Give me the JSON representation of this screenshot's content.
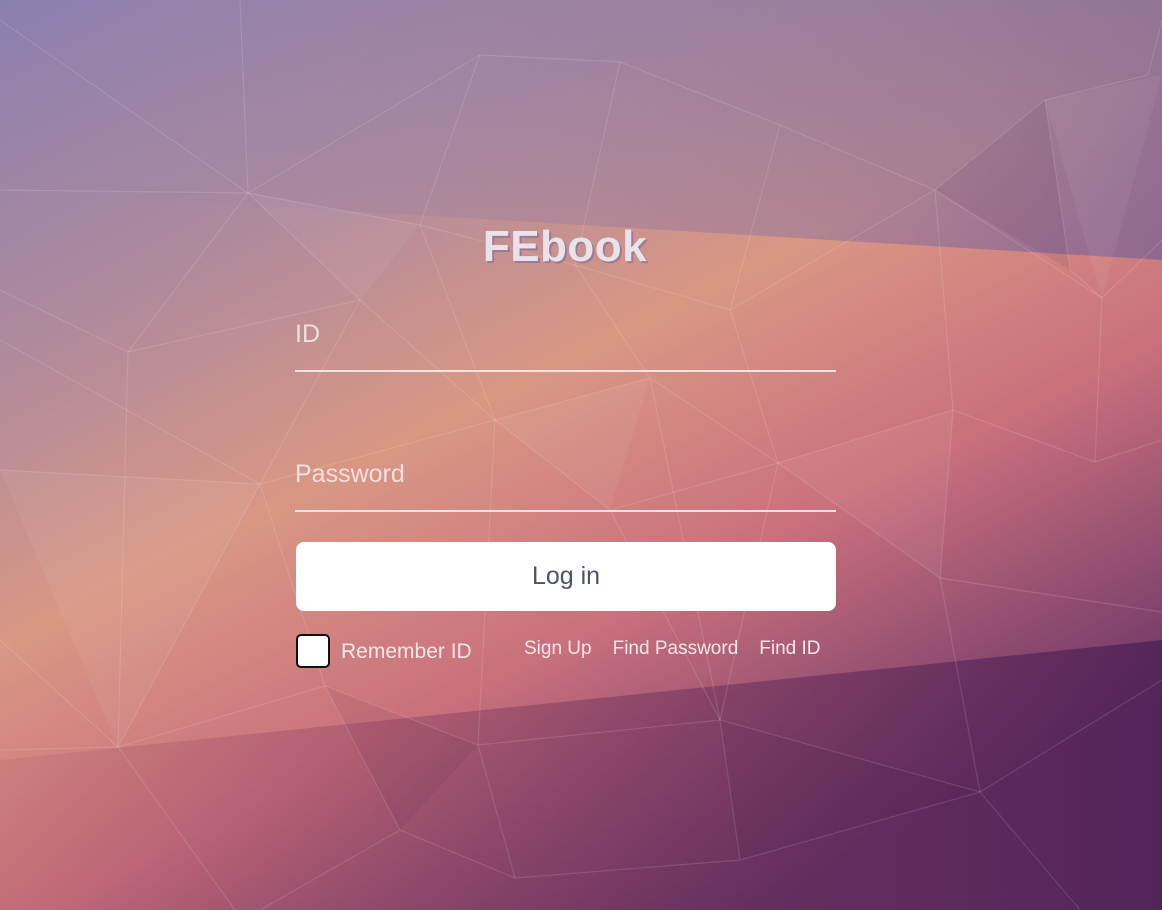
{
  "app": {
    "title": "FEbook"
  },
  "form": {
    "id_placeholder": "ID",
    "id_value": "",
    "password_placeholder": "Password",
    "password_value": "",
    "login_label": "Log in",
    "remember_label": "Remember ID",
    "remember_checked": false
  },
  "links": {
    "sign_up": "Sign Up",
    "find_password": "Find Password",
    "find_id": "Find ID"
  },
  "colors": {
    "bg_top": "#7b6fa8",
    "bg_mid": "#d9877a",
    "bg_bottom": "#5f2d63",
    "button_text": "#4a5568"
  }
}
